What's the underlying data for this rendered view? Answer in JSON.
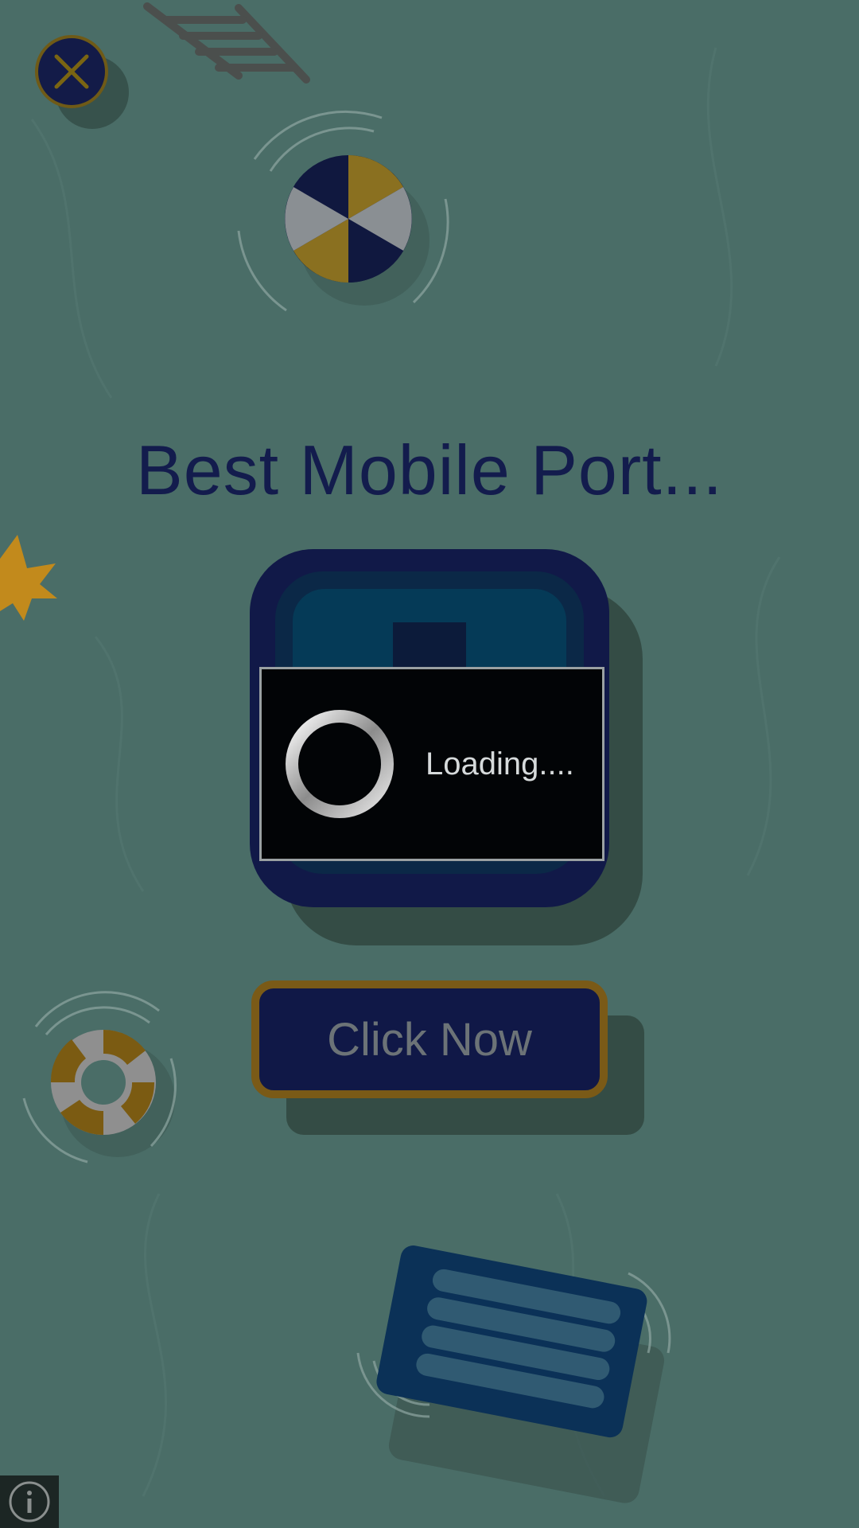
{
  "title": "Best Mobile Port...",
  "loading": {
    "text": "Loading...."
  },
  "cta": {
    "label": "Click Now"
  },
  "colors": {
    "background": "#4a6d67",
    "navy": "#131c4d",
    "gold": "#7a5a17",
    "dialog": "#020406"
  },
  "icons": [
    "close-icon",
    "ladder-icon",
    "beach-ball-icon",
    "maple-leaf-icon",
    "app-icon",
    "spinner-icon",
    "life-ring-icon",
    "pool-float-icon",
    "info-icon"
  ]
}
